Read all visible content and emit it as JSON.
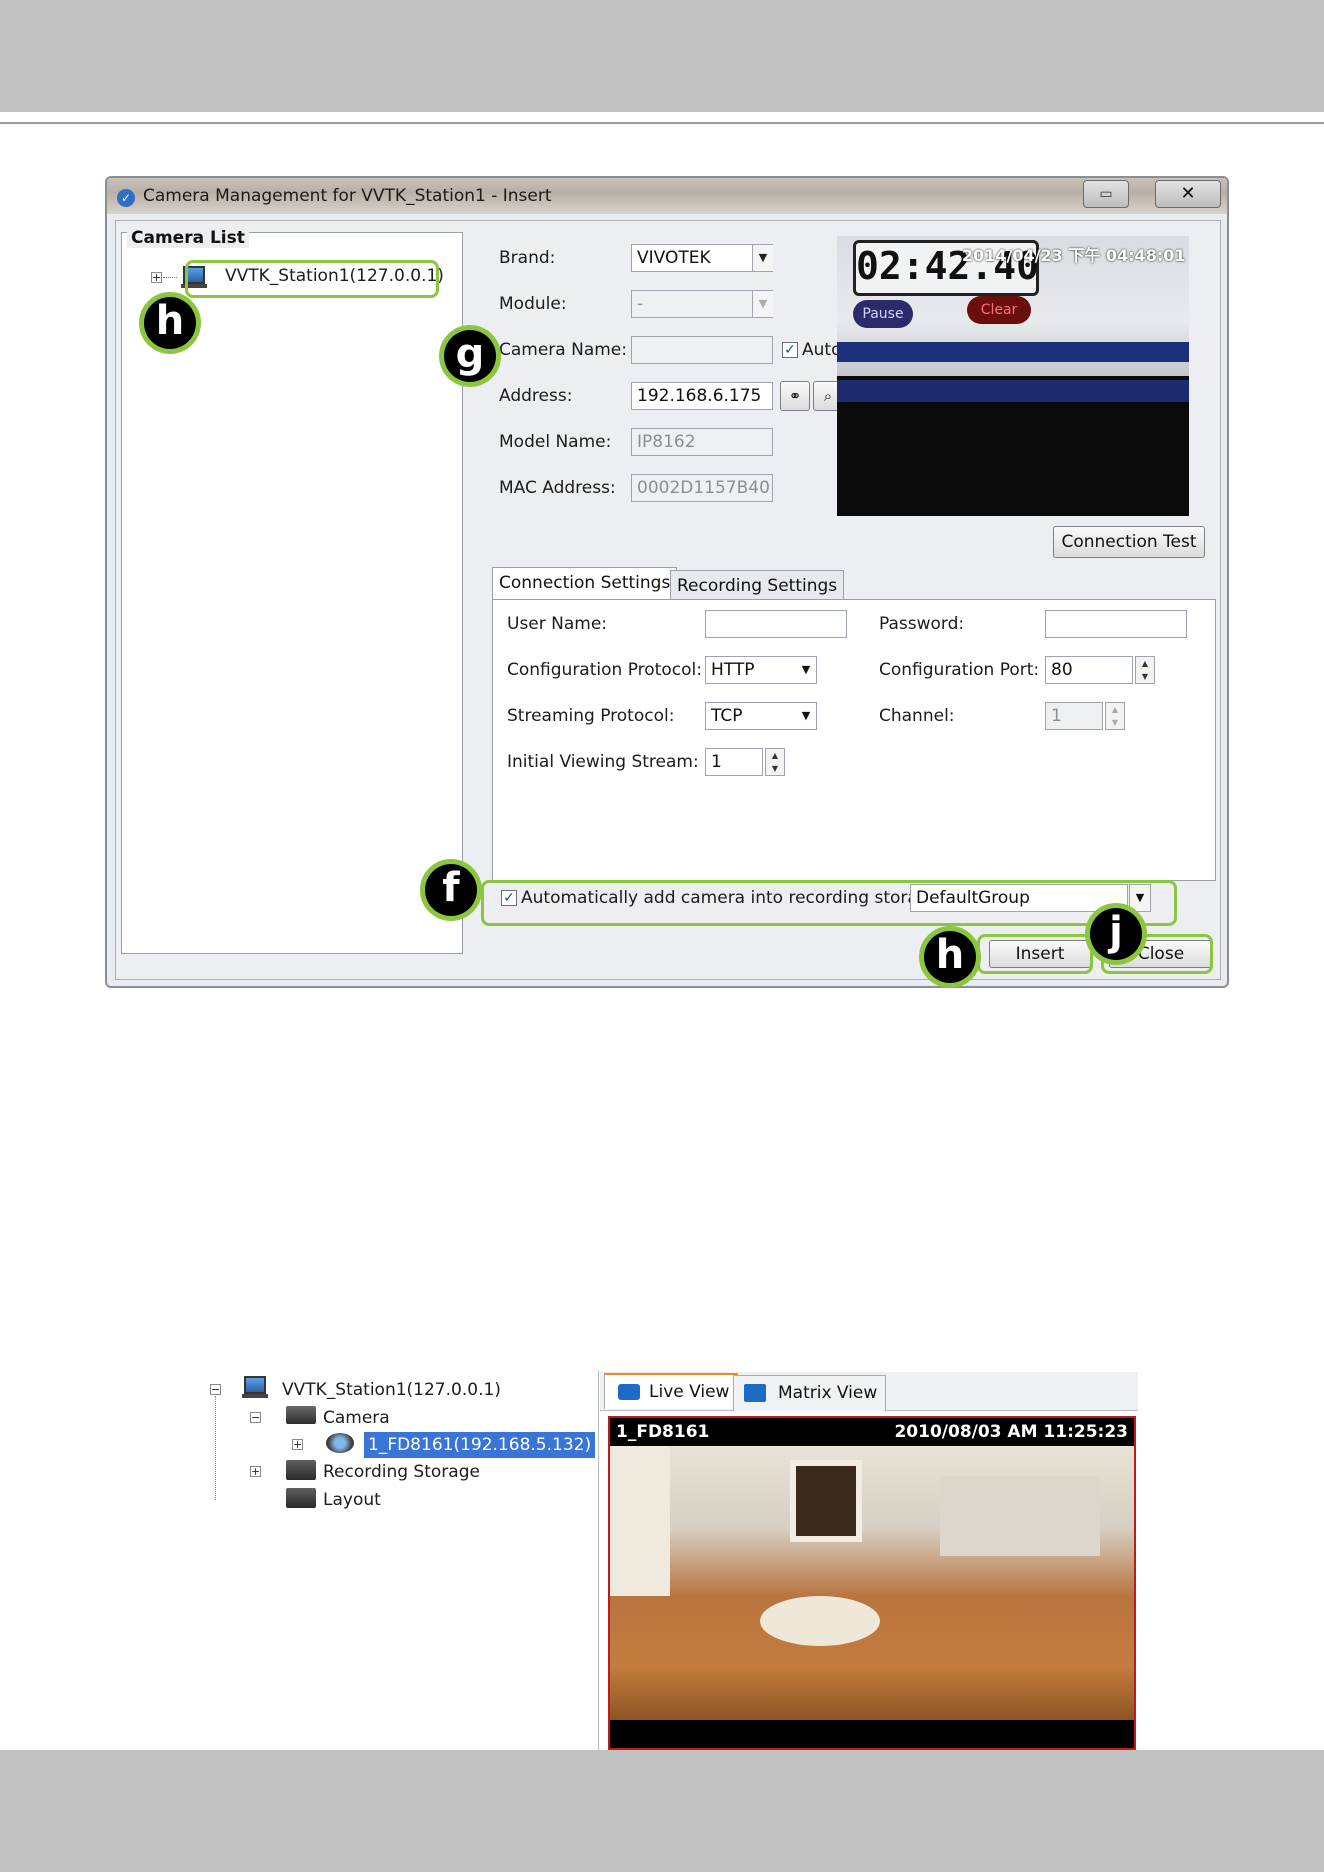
{
  "dialog": {
    "title": "Camera Management for VVTK_Station1 - Insert",
    "restore_glyph": "▭",
    "close_glyph": "✕",
    "camera_list_caption": "Camera List",
    "station_node": "VVTK_Station1(127.0.0.1)",
    "fields": {
      "brand_label": "Brand:",
      "brand_value": "VIVOTEK",
      "module_label": "Module:",
      "module_value": "-",
      "camera_name_label": "Camera Name:",
      "camera_name_value": "",
      "auto_label": "Auto",
      "auto_checked": true,
      "address_label": "Address:",
      "address_value": "192.168.6.175",
      "model_name_label": "Model Name:",
      "model_name_value": "IP8162",
      "mac_label": "MAC Address:",
      "mac_value": "0002D1157B40"
    },
    "preview": {
      "clock": "02:42.40",
      "timestamp": "2014/04/23 下午 04:48:01",
      "pause": "Pause",
      "clear": "Clear"
    },
    "connection_test_label": "Connection Test",
    "tabs": [
      "Connection Settings",
      "Recording Settings"
    ],
    "connection": {
      "user_name_label": "User Name:",
      "user_name_value": "",
      "password_label": "Password:",
      "password_value": "",
      "config_protocol_label": "Configuration Protocol:",
      "config_protocol_value": "HTTP",
      "config_port_label": "Configuration Port:",
      "config_port_value": "80",
      "streaming_protocol_label": "Streaming Protocol:",
      "streaming_protocol_value": "TCP",
      "channel_label": "Channel:",
      "channel_value": "1",
      "initial_stream_label": "Initial Viewing Stream:",
      "initial_stream_value": "1"
    },
    "auto_add_label": "Automatically add camera into recording storage",
    "auto_add_checked": true,
    "group_value": "DefaultGroup",
    "insert_label": "Insert",
    "close_label": "Close"
  },
  "callouts": {
    "h_top": "h",
    "g": "g",
    "f": "f",
    "h_insert": "h",
    "j": "j"
  },
  "tree": {
    "station": "VVTK_Station1(127.0.0.1)",
    "camera_folder": "Camera",
    "camera_item": "1_FD8161(192.168.5.132)",
    "recording_storage": "Recording Storage",
    "layout": "Layout"
  },
  "view": {
    "tabs": [
      "Live View",
      "Matrix View"
    ],
    "camera_name": "1_FD8161",
    "timestamp": "2010/08/03 AM 11:25:23"
  },
  "colors": {
    "callout_green": "#8cc63f",
    "page_band": "#c1c2c1",
    "selection_blue": "#3875d7",
    "video_border": "#c01a1a"
  }
}
